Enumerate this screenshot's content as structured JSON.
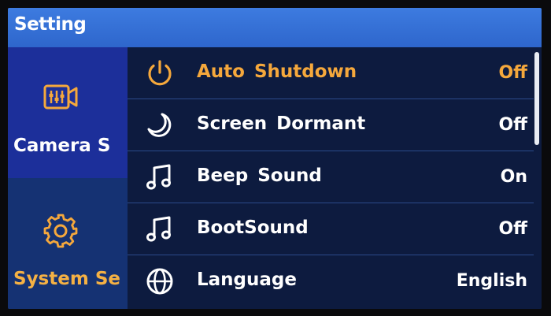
{
  "header": {
    "title": "Setting"
  },
  "sidebar": {
    "items": [
      {
        "label": "Camera S",
        "icon": "video-settings-icon",
        "selected": false
      },
      {
        "label": "System Se",
        "icon": "gear-icon",
        "selected": true
      }
    ]
  },
  "settings": {
    "rows": [
      {
        "label": "Auto Shutdown",
        "value": "Off",
        "icon": "power-icon",
        "active": true
      },
      {
        "label": "Screen Dormant",
        "value": "Off",
        "icon": "moon-icon",
        "active": false
      },
      {
        "label": "Beep Sound",
        "value": "On",
        "icon": "music-note-icon",
        "active": false
      },
      {
        "label": "BootSound",
        "value": "Off",
        "icon": "music-note-icon",
        "active": false
      },
      {
        "label": "Language",
        "value": "English",
        "icon": "globe-icon",
        "active": false
      }
    ]
  },
  "colors": {
    "title_bar": "#3674d8",
    "active_text": "#f5a83c",
    "sidebar_active_label": "#f5b144",
    "background": "#0d1b3f"
  }
}
